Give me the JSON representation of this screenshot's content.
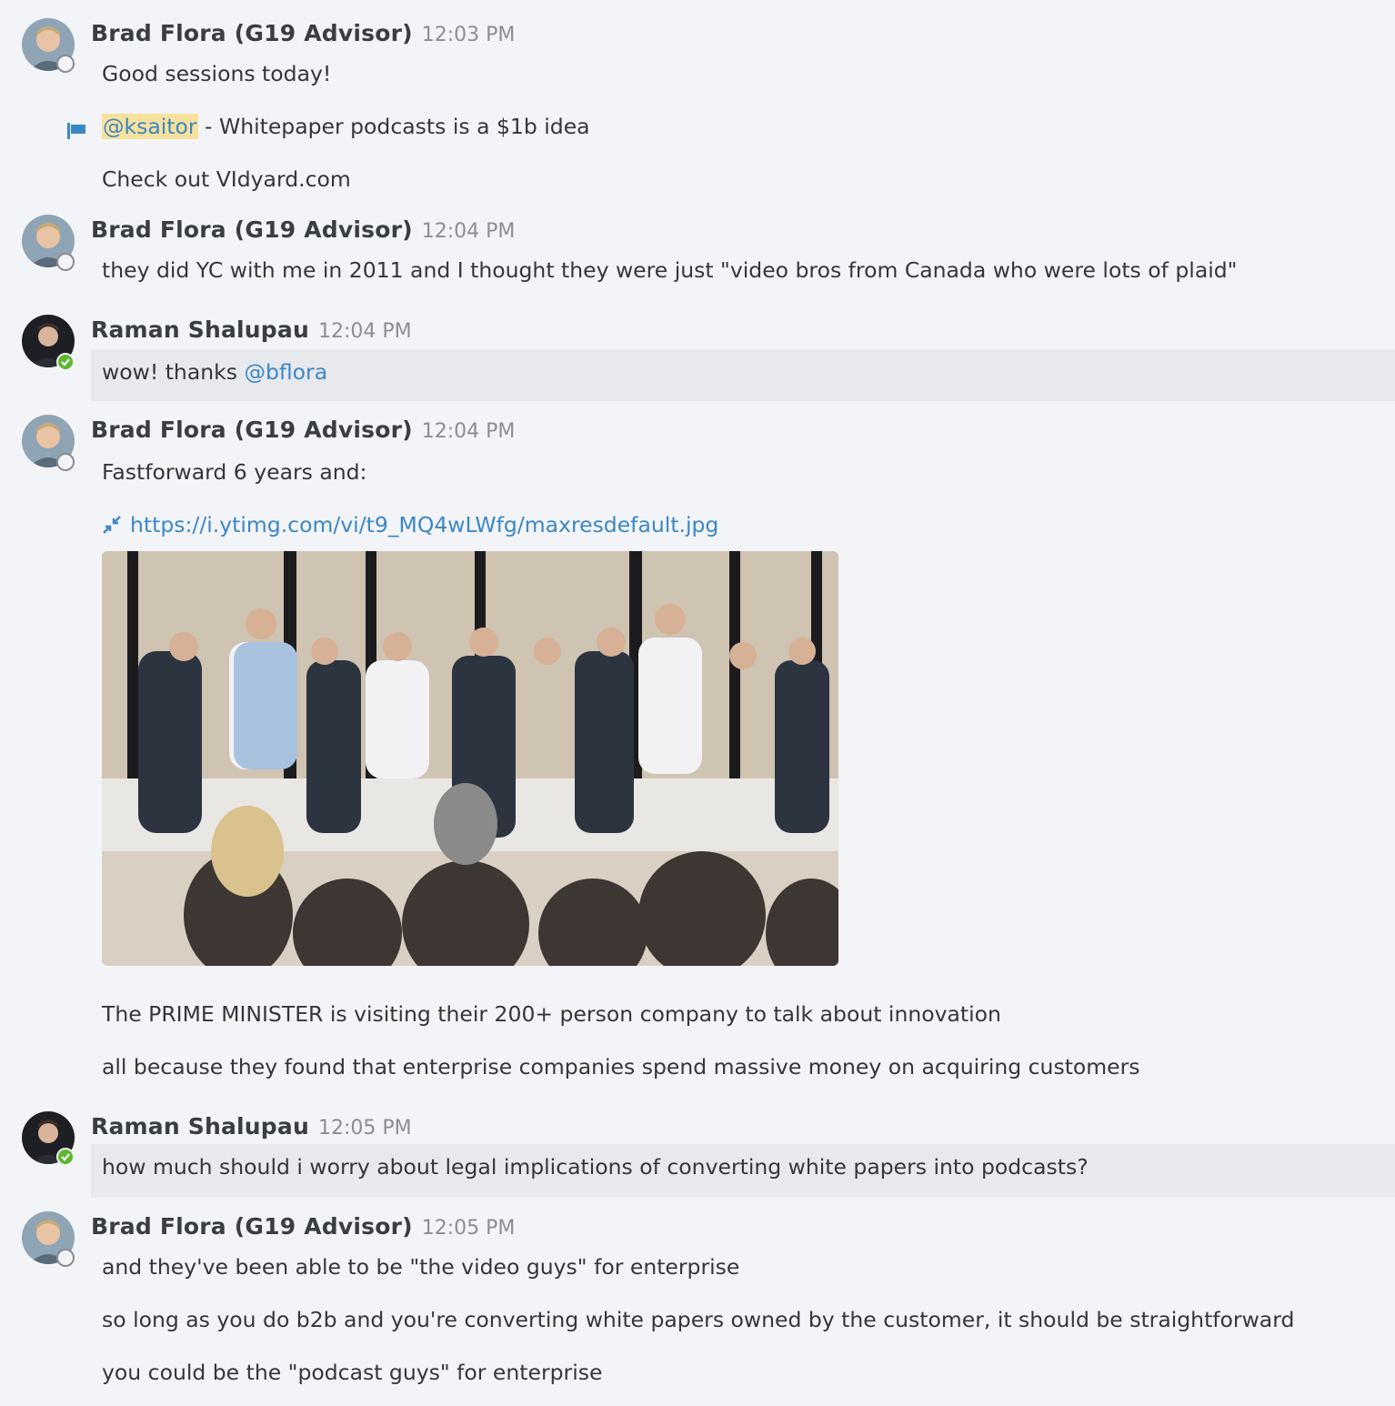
{
  "messages": {
    "m1": {
      "sender": "Brad Flora (G19 Advisor)",
      "time": "12:03 PM",
      "lines": [
        "Good sessions today!",
        "- Whitepaper podcasts is a $1b idea",
        "Check out VIdyard.com"
      ],
      "mention": "@ksaitor"
    },
    "m2": {
      "sender": "Brad Flora (G19 Advisor)",
      "time": "12:04 PM",
      "lines": [
        "they did YC with me in 2011 and I thought they were just \"video bros from Canada who were lots of plaid\""
      ]
    },
    "m3": {
      "sender": "Raman Shalupau",
      "time": "12:04 PM",
      "text": "wow! thanks",
      "mention": "@bflora"
    },
    "m4": {
      "sender": "Brad Flora (G19 Advisor)",
      "time": "12:04 PM",
      "lines": [
        "Fastforward 6 years and:",
        "The PRIME MINISTER is visiting their 200+ person company to talk about innovation",
        "all because they found that enterprise companies spend massive money on acquiring customers"
      ],
      "link": "https://i.ytimg.com/vi/t9_MQ4wLWfg/maxresdefault.jpg"
    },
    "m5": {
      "sender": "Raman Shalupau",
      "time": "12:05 PM",
      "lines": [
        "how much should i worry about legal implications of converting white papers into podcasts?"
      ]
    },
    "m6": {
      "sender": "Brad Flora (G19 Advisor)",
      "time": "12:05 PM",
      "lines": [
        "and they've been able to be \"the video guys\" for enterprise",
        "so long as you do b2b and you're converting white papers owned by the customer, it should be straightforward",
        "you could be the \"podcast guys\" for enterprise"
      ]
    }
  },
  "icons": {
    "flag": "flag-icon",
    "collapse": "collapse-arrows-icon",
    "online": "online-check-icon",
    "offline": "offline-status-icon"
  },
  "colors": {
    "background": "#f3f4f7",
    "highlight": "#e8e9ed",
    "link": "#3a87c8",
    "mention_self_bg": "#f8e19c",
    "online": "#5cb82e"
  }
}
